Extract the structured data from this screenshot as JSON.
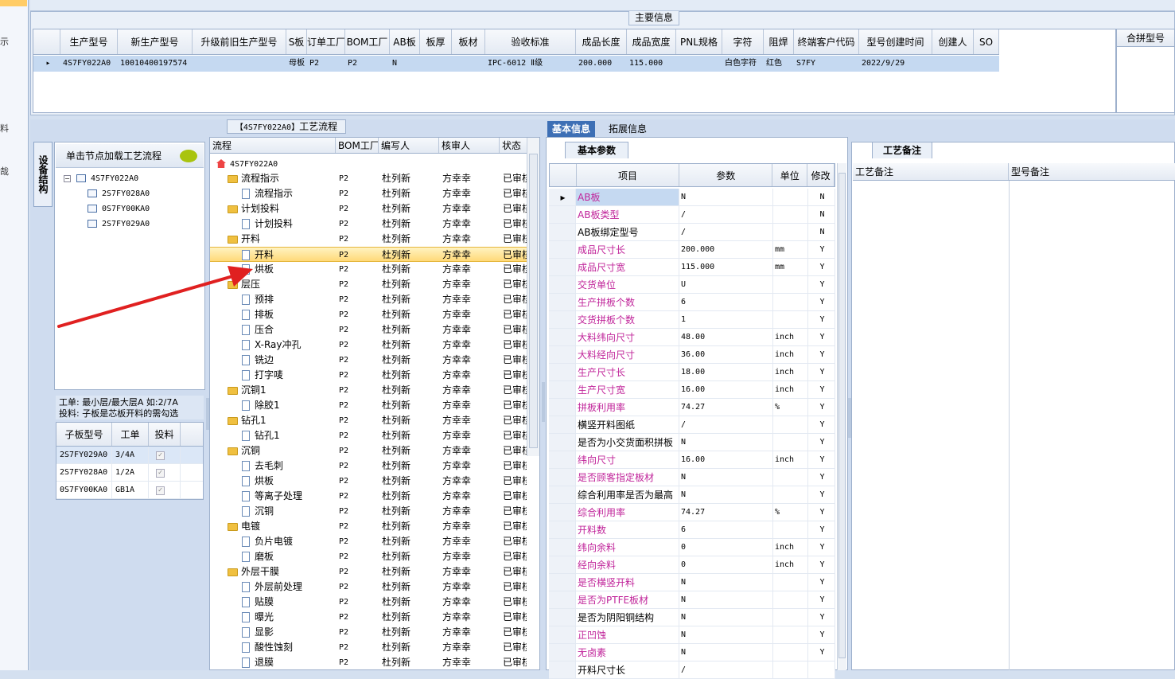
{
  "sidebar": {
    "marks": [
      "示",
      "料",
      "哉"
    ]
  },
  "main_info": {
    "title": "主要信息",
    "columns": [
      "生产型号",
      "新生产型号",
      "升级前旧生产型号",
      "S板",
      "订单工厂",
      "BOM工厂",
      "AB板",
      "板厚",
      "板材",
      "验收标准",
      "成品长度",
      "成品宽度",
      "PNL规格",
      "字符",
      "阻焊",
      "终端客户代码",
      "型号创建时间",
      "创建人",
      "SO"
    ],
    "row": [
      "4S7FY022A0",
      "10010400197574",
      "",
      "母板",
      "P2",
      "P2",
      "N",
      "",
      "",
      "IPC-6012 Ⅱ级",
      "200.000",
      "115.000",
      "",
      "白色字符",
      "红色",
      "S7FY",
      "2022/9/29",
      "",
      ""
    ],
    "right_header": "合拼型号"
  },
  "left": {
    "side_tab": "设备结构",
    "tree_header": "单击节点加载工艺流程",
    "tree": [
      "4S7FY022A0",
      "2S7FY028A0",
      "0S7FY00KA0",
      "2S7FY029A0"
    ],
    "note_line1": "工单: 最小层/最大层A 如:2/7A",
    "note_line2": "投料: 子板是芯板开料的需勾选",
    "sub_columns": [
      "子板型号",
      "工单",
      "投料"
    ],
    "sub_rows": [
      [
        "2S7FY029A0",
        "3/4A",
        "✓"
      ],
      [
        "2S7FY028A0",
        "1/2A",
        "✓"
      ],
      [
        "0S7FY00KA0",
        "GB1A",
        "✓"
      ]
    ]
  },
  "flow": {
    "title_model": "【4S7FY022A0】",
    "title_text": "工艺流程",
    "columns": [
      "流程",
      "BOM工厂",
      "编写人",
      "核审人",
      "状态"
    ],
    "root": "4S7FY022A0",
    "rows": [
      {
        "name": "流程指示",
        "level": 1,
        "type": "folder"
      },
      {
        "name": "流程指示",
        "level": 2,
        "type": "doc"
      },
      {
        "name": "计划投料",
        "level": 1,
        "type": "folder"
      },
      {
        "name": "计划投料",
        "level": 2,
        "type": "doc"
      },
      {
        "name": "开料",
        "level": 1,
        "type": "folder"
      },
      {
        "name": "开料",
        "level": 2,
        "type": "doc",
        "selected": true
      },
      {
        "name": "烘板",
        "level": 2,
        "type": "doc"
      },
      {
        "name": "层压",
        "level": 1,
        "type": "folder"
      },
      {
        "name": "预排",
        "level": 2,
        "type": "doc"
      },
      {
        "name": "排板",
        "level": 2,
        "type": "doc"
      },
      {
        "name": "压合",
        "level": 2,
        "type": "doc"
      },
      {
        "name": "X-Ray冲孔",
        "level": 2,
        "type": "doc"
      },
      {
        "name": "铣边",
        "level": 2,
        "type": "doc"
      },
      {
        "name": "打字唛",
        "level": 2,
        "type": "doc"
      },
      {
        "name": "沉铜1",
        "level": 1,
        "type": "folder"
      },
      {
        "name": "除胶1",
        "level": 2,
        "type": "doc"
      },
      {
        "name": "钻孔1",
        "level": 1,
        "type": "folder"
      },
      {
        "name": "钻孔1",
        "level": 2,
        "type": "doc"
      },
      {
        "name": "沉铜",
        "level": 1,
        "type": "folder"
      },
      {
        "name": "去毛刺",
        "level": 2,
        "type": "doc"
      },
      {
        "name": "烘板",
        "level": 2,
        "type": "doc"
      },
      {
        "name": "等离子处理",
        "level": 2,
        "type": "doc"
      },
      {
        "name": "沉铜",
        "level": 2,
        "type": "doc"
      },
      {
        "name": "电镀",
        "level": 1,
        "type": "folder"
      },
      {
        "name": "负片电镀",
        "level": 2,
        "type": "doc"
      },
      {
        "name": "磨板",
        "level": 2,
        "type": "doc"
      },
      {
        "name": "外层干膜",
        "level": 1,
        "type": "folder"
      },
      {
        "name": "外层前处理",
        "level": 2,
        "type": "doc"
      },
      {
        "name": "贴膜",
        "level": 2,
        "type": "doc"
      },
      {
        "name": "曝光",
        "level": 2,
        "type": "doc"
      },
      {
        "name": "显影",
        "level": 2,
        "type": "doc"
      },
      {
        "name": "酸性蚀刻",
        "level": 2,
        "type": "doc"
      },
      {
        "name": "退膜",
        "level": 2,
        "type": "doc"
      }
    ],
    "bom": "P2",
    "writer": "杜列新",
    "auditor": "方幸幸",
    "status": "已审核"
  },
  "tabs": {
    "basic": "基本信息",
    "ext": "拓展信息"
  },
  "basic": {
    "tab": "基本参数",
    "columns": [
      "项目",
      "参数",
      "单位",
      "修改"
    ],
    "rows": [
      [
        "AB板",
        "N",
        "",
        "N",
        true
      ],
      [
        "AB板类型",
        "/",
        "",
        "N",
        true
      ],
      [
        "AB板绑定型号",
        "/",
        "",
        "N",
        false
      ],
      [
        "成品尺寸长",
        "200.000",
        "mm",
        "Y",
        true
      ],
      [
        "成品尺寸宽",
        "115.000",
        "mm",
        "Y",
        true
      ],
      [
        "交货单位",
        "U",
        "",
        "Y",
        true
      ],
      [
        "生产拼板个数",
        "6",
        "",
        "Y",
        true
      ],
      [
        "交货拼板个数",
        "1",
        "",
        "Y",
        true
      ],
      [
        "大料纬向尺寸",
        "48.00",
        "inch",
        "Y",
        true
      ],
      [
        "大料经向尺寸",
        "36.00",
        "inch",
        "Y",
        true
      ],
      [
        "生产尺寸长",
        "18.00",
        "inch",
        "Y",
        true
      ],
      [
        "生产尺寸宽",
        "16.00",
        "inch",
        "Y",
        true
      ],
      [
        "拼板利用率",
        "74.27",
        "%",
        "Y",
        true
      ],
      [
        "横竖开料图纸",
        "/",
        "",
        "Y",
        false
      ],
      [
        "是否为小交货面积拼板",
        "N",
        "",
        "Y",
        false
      ],
      [
        "纬向尺寸",
        "16.00",
        "inch",
        "Y",
        true
      ],
      [
        "是否顾客指定板材",
        "N",
        "",
        "Y",
        true
      ],
      [
        "综合利用率是否为最高",
        "N",
        "",
        "Y",
        false
      ],
      [
        "综合利用率",
        "74.27",
        "%",
        "Y",
        true
      ],
      [
        "开料数",
        "6",
        "",
        "Y",
        true
      ],
      [
        "纬向余料",
        "0",
        "inch",
        "Y",
        true
      ],
      [
        "经向余料",
        "0",
        "inch",
        "Y",
        true
      ],
      [
        "是否横竖开料",
        "N",
        "",
        "Y",
        true
      ],
      [
        "是否为PTFE板材",
        "N",
        "",
        "Y",
        true
      ],
      [
        "是否为阴阳铜结构",
        "N",
        "",
        "Y",
        false
      ],
      [
        "正凹蚀",
        "N",
        "",
        "Y",
        true
      ],
      [
        "无卤素",
        "N",
        "",
        "Y",
        true
      ],
      [
        "开料尺寸长",
        "/",
        "",
        "",
        false
      ]
    ]
  },
  "remarks": {
    "tab": "工艺备注",
    "col1": "工艺备注",
    "col2": "型号备注"
  },
  "colors": {
    "accent": "#3d6fb5",
    "purple_text": "#c0249a",
    "arrow": "#e02020",
    "selection": "#ffd978"
  }
}
